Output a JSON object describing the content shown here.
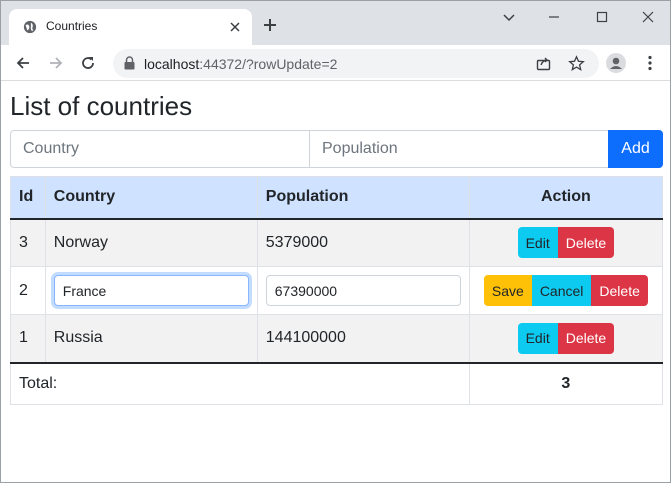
{
  "browser": {
    "tab_title": "Countries",
    "url_host": "localhost",
    "url_rest": ":44372/?rowUpdate=2"
  },
  "page": {
    "title": "List of countries",
    "country_placeholder": "Country",
    "population_placeholder": "Population",
    "add_label": "Add"
  },
  "table": {
    "headers": {
      "id": "Id",
      "country": "Country",
      "population": "Population",
      "action": "Action"
    },
    "rows": [
      {
        "id": "3",
        "country": "Norway",
        "population": "5379000"
      },
      {
        "id": "2",
        "country": "France",
        "population": "67390000"
      },
      {
        "id": "1",
        "country": "Russia",
        "population": "144100000"
      }
    ],
    "edit_label": "Edit",
    "delete_label": "Delete",
    "save_label": "Save",
    "cancel_label": "Cancel",
    "total_label": "Total:",
    "total_value": "3"
  },
  "colors": {
    "primary": "#0d6efd",
    "info": "#0dcaf0",
    "danger": "#dc3545",
    "warning": "#ffc107",
    "header_bg": "#cfe2ff"
  }
}
